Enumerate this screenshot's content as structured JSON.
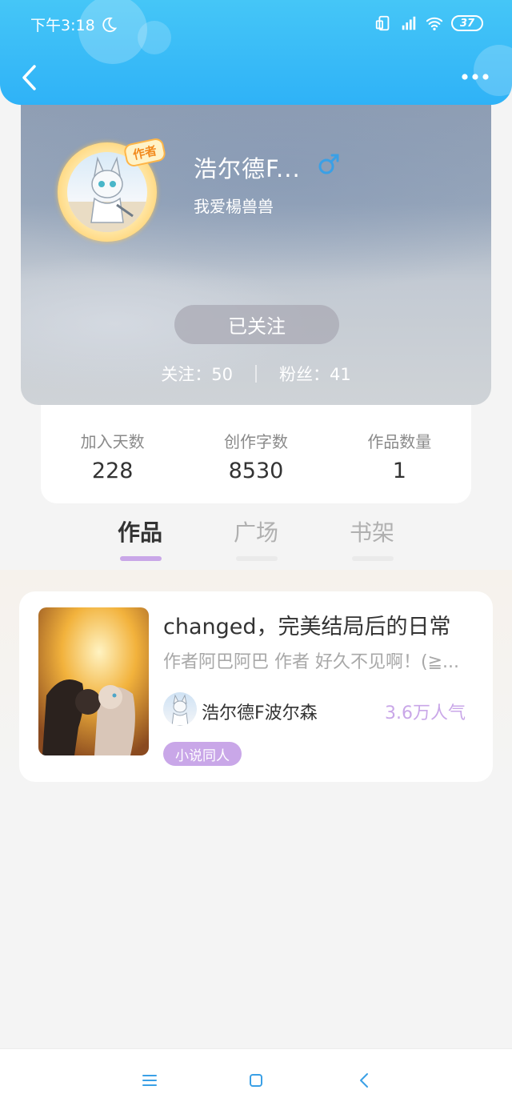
{
  "status_bar": {
    "time": "下午3:18",
    "battery": "37",
    "network": "HD"
  },
  "header": {
    "back_icon": "chevron-left-icon",
    "more_icon": "more-horizontal-icon"
  },
  "profile": {
    "username": "浩尔德F...",
    "gender_icon": "male-icon",
    "bio": "我爱楊兽兽",
    "author_badge": "作者",
    "follow_button": "已关注",
    "following_label": "关注：",
    "following_count": "50",
    "fans_label": "粉丝：",
    "fans_count": "41"
  },
  "stats": [
    {
      "label": "加入天数",
      "value": "228"
    },
    {
      "label": "创作字数",
      "value": "8530"
    },
    {
      "label": "作品数量",
      "value": "1"
    }
  ],
  "tabs": [
    {
      "label": "作品",
      "active": true
    },
    {
      "label": "广场",
      "active": false
    },
    {
      "label": "书架",
      "active": false
    }
  ],
  "works": [
    {
      "title": "changed，完美结局后的日常",
      "description": "作者阿巴阿巴 作者 好久不见啊！(≧...",
      "author": "浩尔德F波尔森",
      "popularity": "3.6万人气",
      "tag": "小说同人"
    }
  ],
  "bottom_nav": {
    "menu_icon": "menu-icon",
    "home_icon": "square-home-icon",
    "back_icon": "back-triangle-icon"
  },
  "colors": {
    "header_blue": "#2fb2f7",
    "accent_purple": "#c9a7e8",
    "nav_icon_blue": "#3aa0e6"
  }
}
